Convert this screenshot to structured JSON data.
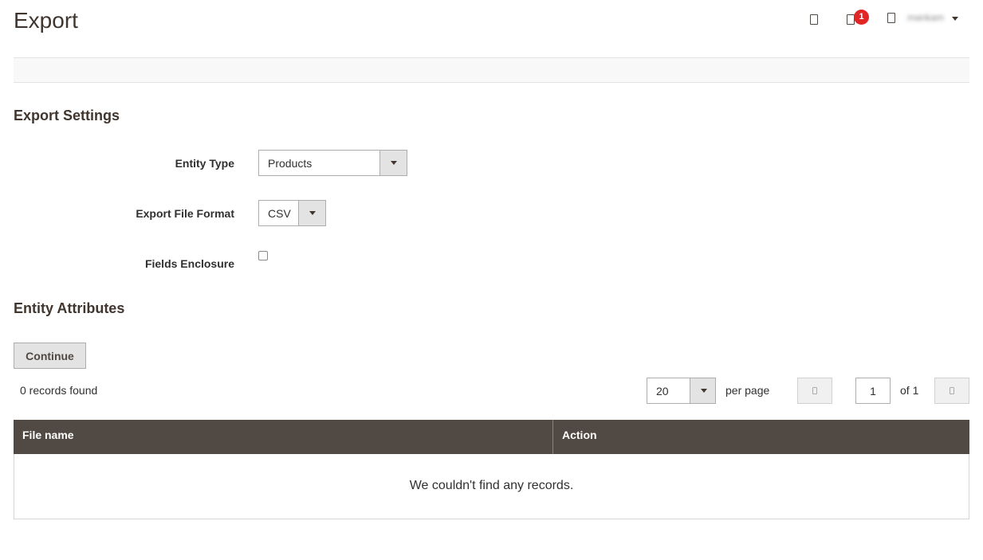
{
  "header": {
    "title": "Export",
    "icons": [
      "dashboard-icon",
      "bell-icon",
      "user-icon"
    ],
    "notification_count": "1",
    "user_name": "mankam"
  },
  "export_settings": {
    "title": "Export Settings",
    "entity_type": {
      "label": "Entity Type",
      "value": "Products"
    },
    "file_format": {
      "label": "Export File Format",
      "value": "CSV"
    },
    "fields_enclosure": {
      "label": "Fields Enclosure",
      "checked": false
    }
  },
  "entity_attributes": {
    "title": "Entity Attributes"
  },
  "actions": {
    "continue_label": "Continue"
  },
  "grid": {
    "records_found": "0 records found",
    "per_page_value": "20",
    "per_page_label": "per page",
    "current_page": "1",
    "page_total": "of 1",
    "columns": [
      "File name",
      "Action"
    ],
    "empty_message": "We couldn't find any records."
  },
  "colors": {
    "header_bg": "#514943",
    "badge": "#e22626",
    "title": "#41362f"
  }
}
